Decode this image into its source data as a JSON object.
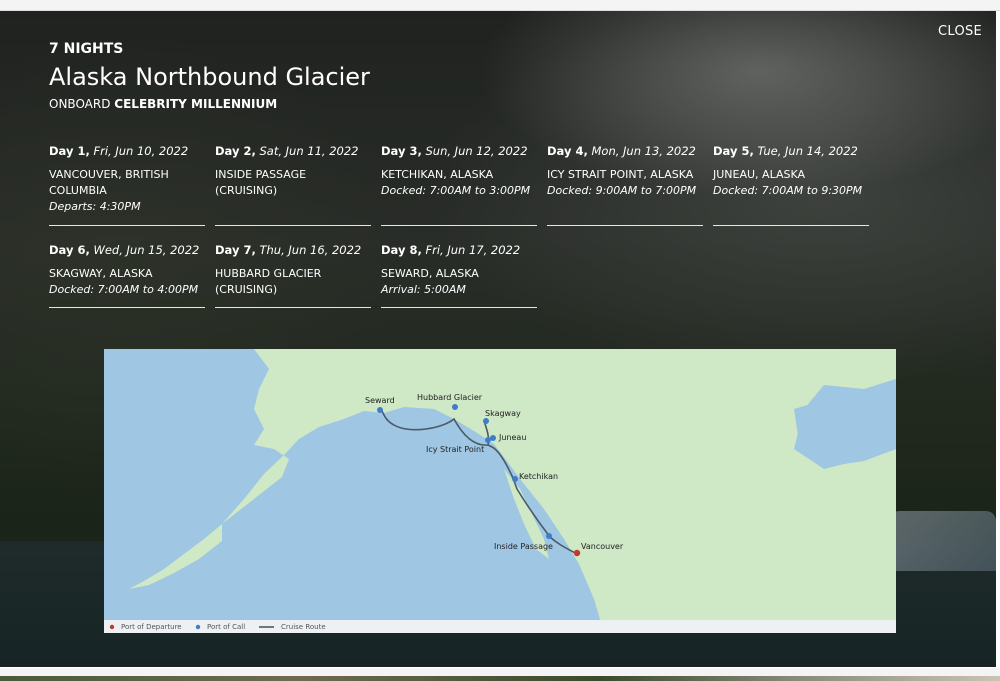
{
  "modal": {
    "close_label": "CLOSE",
    "nights": "7 NIGHTS",
    "title": "Alaska Northbound Glacier",
    "onboard_prefix": "ONBOARD",
    "ship": "CELEBRITY MILLENNIUM"
  },
  "itinerary": [
    {
      "day": "Day 1,",
      "date": "Fri, Jun 10, 2022",
      "place": "VANCOUVER, BRITISH COLUMBIA",
      "note": "Departs: 4:30PM"
    },
    {
      "day": "Day 2,",
      "date": "Sat, Jun 11, 2022",
      "place": "INSIDE PASSAGE (CRUISING)",
      "note": ""
    },
    {
      "day": "Day 3,",
      "date": "Sun, Jun 12, 2022",
      "place": "KETCHIKAN, ALASKA",
      "note": "Docked: 7:00AM to 3:00PM"
    },
    {
      "day": "Day 4,",
      "date": "Mon, Jun 13, 2022",
      "place": "ICY STRAIT POINT, ALASKA",
      "note": "Docked: 9:00AM to 7:00PM"
    },
    {
      "day": "Day 5,",
      "date": "Tue, Jun 14, 2022",
      "place": "JUNEAU, ALASKA",
      "note": "Docked: 7:00AM to 9:30PM"
    },
    {
      "day": "Day 6,",
      "date": "Wed, Jun 15, 2022",
      "place": "SKAGWAY, ALASKA",
      "note": "Docked: 7:00AM to 4:00PM"
    },
    {
      "day": "Day 7,",
      "date": "Thu, Jun 16, 2022",
      "place": "HUBBARD GLACIER (CRUISING)",
      "note": ""
    },
    {
      "day": "Day 8,",
      "date": "Fri, Jun 17, 2022",
      "place": "SEWARD, ALASKA",
      "note": "Arrival: 5:00AM"
    }
  ],
  "map": {
    "ports": [
      "Seward",
      "Hubbard Glacier",
      "Skagway",
      "Juneau",
      "Icy Strait Point",
      "Ketchikan",
      "Inside Passage",
      "Vancouver"
    ],
    "legend": {
      "departure": "Port of Departure",
      "call": "Port of Call",
      "route": "Cruise Route"
    },
    "colors": {
      "departure": "#c0392b",
      "call": "#3d7ec9",
      "route": "#4a5a66",
      "land": "#cfe8c6",
      "water": "#9fc6e3"
    }
  }
}
